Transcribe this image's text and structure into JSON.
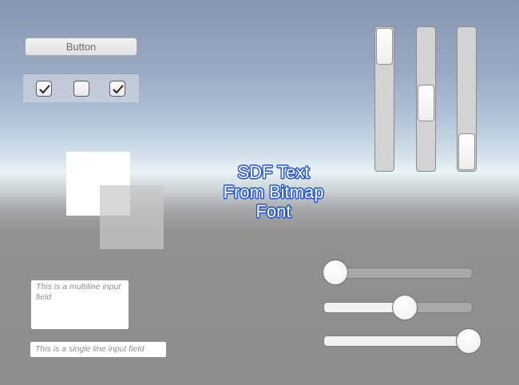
{
  "button": {
    "label": "Button"
  },
  "toggles": [
    {
      "checked": true
    },
    {
      "checked": false
    },
    {
      "checked": true
    }
  ],
  "sdf_text": {
    "lines": [
      "SDF Text",
      "From Bitmap",
      "Font"
    ]
  },
  "scrollbars": [
    {
      "value": 0.0
    },
    {
      "value": 0.5
    },
    {
      "value": 1.0
    }
  ],
  "sliders": [
    {
      "value": 0.0
    },
    {
      "value": 0.5
    },
    {
      "value": 1.0
    }
  ],
  "inputs": {
    "multiline_placeholder": "This is a multiline input field",
    "singleline_placeholder": "This is a single line input field"
  },
  "colors": {
    "sdf_outline": "#1a4fd6",
    "slider_fill": "#f1f1f1",
    "slider_track": "#a8a8a8"
  },
  "icons": {
    "toggle_check": "checkmark-icon"
  }
}
